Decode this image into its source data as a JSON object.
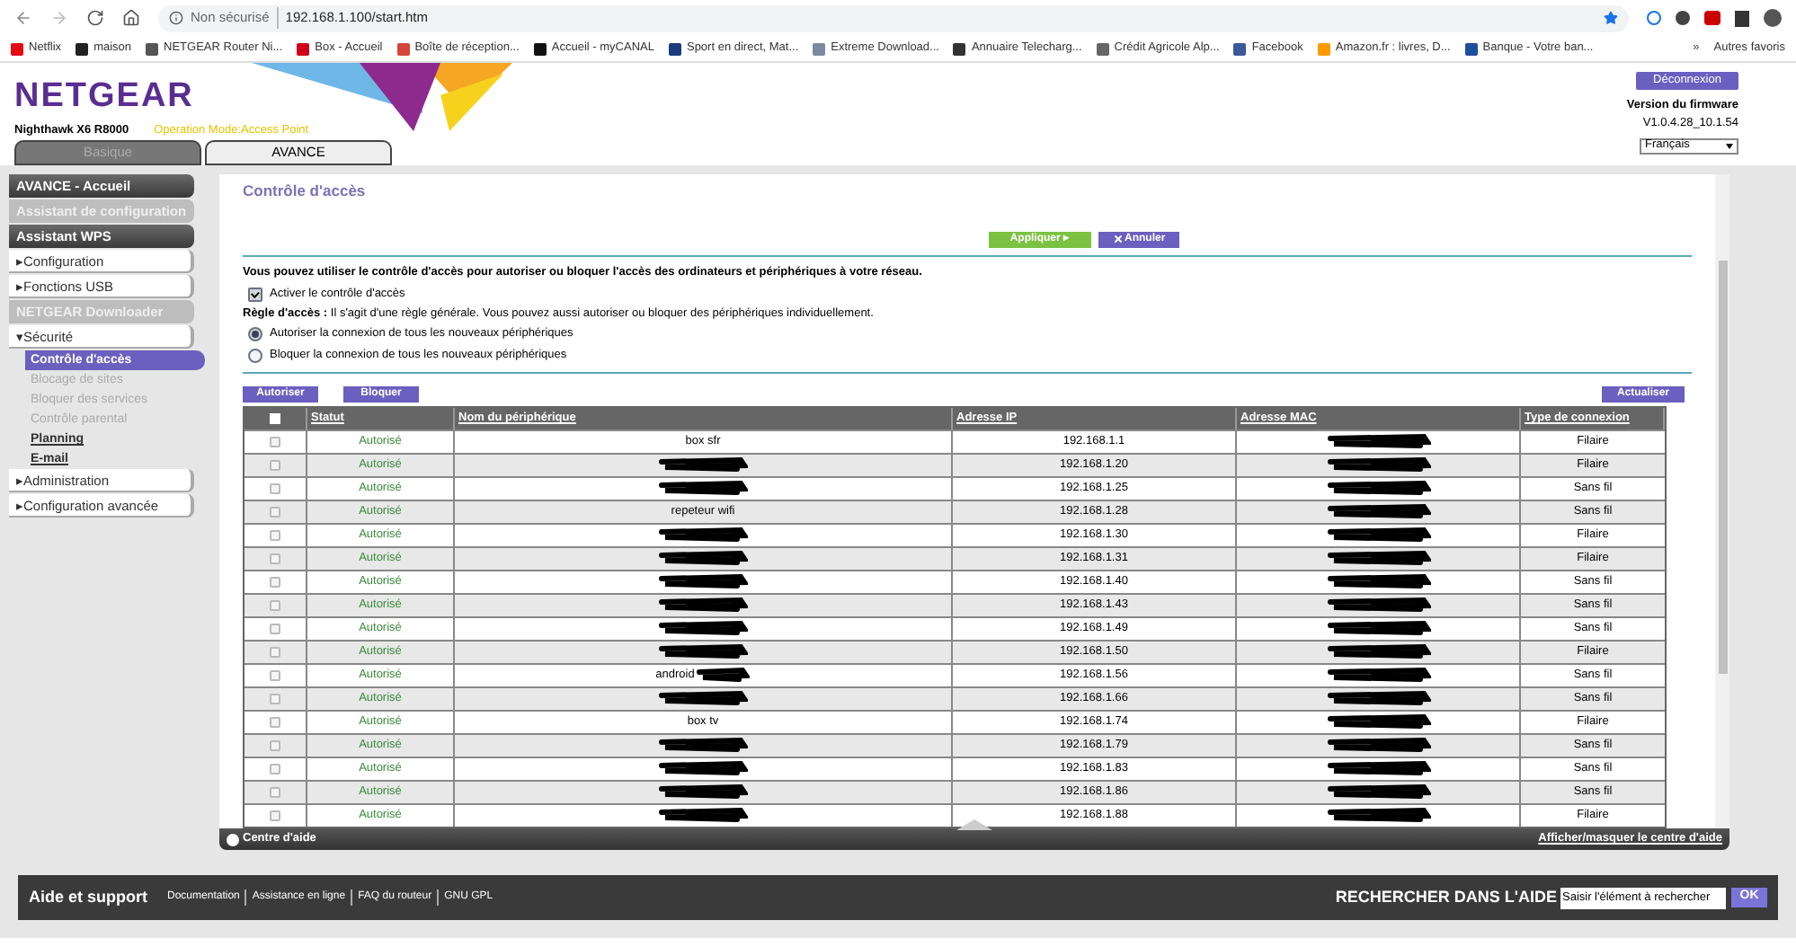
{
  "browser": {
    "security": "Non sécurisé",
    "url": "192.168.1.100/start.htm",
    "bookmarks": [
      {
        "label": "Netflix",
        "color": "#e50914"
      },
      {
        "label": "maison",
        "color": "#222222"
      },
      {
        "label": "NETGEAR Router Ni...",
        "color": "#555555"
      },
      {
        "label": "Box - Accueil",
        "color": "#d0021b"
      },
      {
        "label": "Boîte de réception...",
        "color": "#d44638"
      },
      {
        "label": "Accueil - myCANAL",
        "color": "#111111"
      },
      {
        "label": "Sport en direct, Mat...",
        "color": "#1a3d7c"
      },
      {
        "label": "Extreme Download...",
        "color": "#7a8aa0"
      },
      {
        "label": "Annuaire Telecharg...",
        "color": "#333333"
      },
      {
        "label": "Crédit Agricole Alp...",
        "color": "#666666"
      },
      {
        "label": "Facebook",
        "color": "#3b5998"
      },
      {
        "label": "Amazon.fr : livres, D...",
        "color": "#ff9900"
      },
      {
        "label": "Banque - Votre ban...",
        "color": "#1f4e9c"
      }
    ],
    "more": "»",
    "other_bookmarks": "Autres favoris"
  },
  "header": {
    "logo": "NETGEAR",
    "model": "Nighthawk X6 R8000",
    "mode": "Operation Mode:Access Point",
    "logout": "Déconnexion",
    "firmware_label": "Version du firmware",
    "firmware": "V1.0.4.28_10.1.54",
    "language": "Français",
    "tabs": [
      {
        "label": "Basique",
        "selected": false
      },
      {
        "label": "AVANCE",
        "selected": true
      }
    ]
  },
  "sidebar": [
    {
      "kind": "dark",
      "label": "AVANCE - Accueil"
    },
    {
      "kind": "gray",
      "label": "Assistant de configuration"
    },
    {
      "kind": "dark",
      "label": "Assistant WPS"
    },
    {
      "kind": "white",
      "label": "▸Configuration"
    },
    {
      "kind": "white",
      "label": "▸Fonctions USB"
    },
    {
      "kind": "gray",
      "label": "NETGEAR Downloader"
    },
    {
      "kind": "white",
      "label": "▾Sécurité"
    },
    {
      "kind": "sub",
      "label": "Contrôle d'accès",
      "selected": true,
      "disabled": false
    },
    {
      "kind": "sub",
      "label": "Blocage de sites",
      "selected": false,
      "disabled": true
    },
    {
      "kind": "sub",
      "label": "Bloquer des services",
      "selected": false,
      "disabled": true
    },
    {
      "kind": "sub",
      "label": "Contrôle parental",
      "selected": false,
      "disabled": true
    },
    {
      "kind": "sub",
      "label": "Planning",
      "selected": false,
      "disabled": false
    },
    {
      "kind": "sub",
      "label": "E-mail",
      "selected": false,
      "disabled": false
    },
    {
      "kind": "white",
      "label": "▸Administration"
    },
    {
      "kind": "white",
      "label": "▸Configuration avancée"
    }
  ],
  "page": {
    "title": "Contrôle d'accès",
    "apply": "Appliquer ▸",
    "cancel": "Annuler",
    "intro": "Vous pouvez utiliser le contrôle d'accès pour autoriser ou bloquer l'accès des ordinateurs et périphériques à votre réseau.",
    "enable": {
      "label": "Activer le contrôle d'accès",
      "checked": true
    },
    "rule": "**Règle d'accès :** Il s'agit d'une règle générale. Vous pouvez aussi autoriser ou bloquer des périphériques individuellement.",
    "radios": [
      {
        "label": "Autoriser la connexion de tous les nouveaux périphériques",
        "selected": true
      },
      {
        "label": "Bloquer la connexion de tous les nouveaux périphériques",
        "selected": false
      }
    ],
    "allow": "Autoriser",
    "block": "Bloquer",
    "refresh": "Actualiser"
  },
  "table": {
    "select_all": false,
    "columns": [
      "Statut",
      "Nom du périphérique",
      "Adresse IP",
      "Adresse MAC",
      "Type de connexion"
    ],
    "rows": [
      {
        "checked": false,
        "status": "Autorisé",
        "name": "box sfr",
        "name_redacted": false,
        "ip": "192.168.1.1",
        "mac_redacted": true,
        "type": "Filaire"
      },
      {
        "checked": false,
        "status": "Autorisé",
        "name_redacted": true,
        "ip": "192.168.1.20",
        "mac_redacted": true,
        "type": "Filaire"
      },
      {
        "checked": false,
        "status": "Autorisé",
        "name_redacted": true,
        "ip": "192.168.1.25",
        "mac_redacted": true,
        "type": "Sans fil"
      },
      {
        "checked": false,
        "status": "Autorisé",
        "name": "repeteur wifi",
        "name_redacted": false,
        "ip": "192.168.1.28",
        "mac_redacted": true,
        "type": "Sans fil"
      },
      {
        "checked": false,
        "status": "Autorisé",
        "name_redacted": true,
        "ip": "192.168.1.30",
        "mac_redacted": true,
        "type": "Filaire"
      },
      {
        "checked": false,
        "status": "Autorisé",
        "name_redacted": true,
        "ip": "192.168.1.31",
        "mac_redacted": true,
        "type": "Filaire"
      },
      {
        "checked": false,
        "status": "Autorisé",
        "name_redacted": true,
        "ip": "192.168.1.40",
        "mac_redacted": true,
        "type": "Sans fil"
      },
      {
        "checked": false,
        "status": "Autorisé",
        "name_redacted": true,
        "ip": "192.168.1.43",
        "mac_redacted": true,
        "type": "Sans fil"
      },
      {
        "checked": false,
        "status": "Autorisé",
        "name_redacted": true,
        "ip": "192.168.1.49",
        "mac_redacted": true,
        "type": "Sans fil"
      },
      {
        "checked": false,
        "status": "Autorisé",
        "name_redacted": true,
        "ip": "192.168.1.50",
        "mac_redacted": true,
        "type": "Filaire"
      },
      {
        "checked": false,
        "status": "Autorisé",
        "name": "android",
        "name_redacted": true,
        "ip": "192.168.1.56",
        "mac_redacted": true,
        "type": "Sans fil"
      },
      {
        "checked": false,
        "status": "Autorisé",
        "name_redacted": true,
        "ip": "192.168.1.66",
        "mac_redacted": true,
        "type": "Sans fil"
      },
      {
        "checked": false,
        "status": "Autorisé",
        "name": "box tv",
        "name_redacted": false,
        "ip": "192.168.1.74",
        "mac_redacted": true,
        "type": "Filaire"
      },
      {
        "checked": false,
        "status": "Autorisé",
        "name_redacted": true,
        "ip": "192.168.1.79",
        "mac_redacted": true,
        "type": "Sans fil"
      },
      {
        "checked": false,
        "status": "Autorisé",
        "name_redacted": true,
        "ip": "192.168.1.83",
        "mac_redacted": true,
        "type": "Sans fil"
      },
      {
        "checked": false,
        "status": "Autorisé",
        "name_redacted": true,
        "ip": "192.168.1.86",
        "mac_redacted": true,
        "type": "Sans fil"
      },
      {
        "checked": false,
        "status": "Autorisé",
        "name_redacted": true,
        "ip": "192.168.1.88",
        "mac_redacted": true,
        "type": "Filaire"
      }
    ]
  },
  "help_bar": {
    "label": "Centre d'aide",
    "toggle": "Afficher/masquer le centre d'aide"
  },
  "footer": {
    "title": "Aide et support",
    "links": [
      "Documentation",
      "Assistance en ligne",
      "FAQ du routeur",
      "GNU GPL"
    ],
    "search_label": "RECHERCHER DANS L'AIDE",
    "search_placeholder": "Saisir l'élément à rechercher",
    "ok": "OK"
  }
}
